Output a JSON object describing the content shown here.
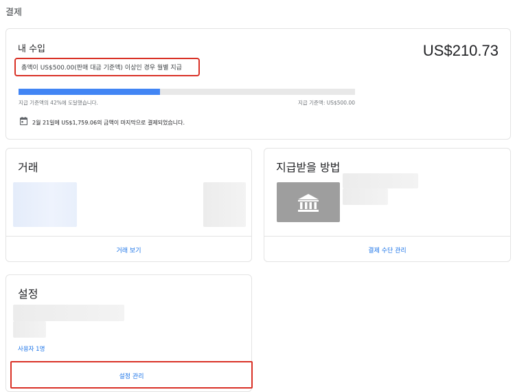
{
  "page": {
    "title": "결제"
  },
  "earnings": {
    "title": "내 수입",
    "amount": "US$210.73",
    "threshold_text": "총액이 US$500.00(판매 대금 기준액) 이상인 경우 월별 지급",
    "progress_fraction": 0.42,
    "progress_left_label": "지급 기준액의 42%에 도달했습니다.",
    "progress_right_label": "지급 기준액: US$500.00",
    "last_payment_text": "2월 21일에 US$1,759.06의 금액이 마지막으로 결제되었습니다.",
    "calendar_icon": "calendar-icon"
  },
  "transactions": {
    "title": "거래",
    "link": "거래 보기"
  },
  "payment_method": {
    "title": "지급받을 방법",
    "bank_icon": "bank-icon",
    "link": "결제 수단 관리"
  },
  "settings": {
    "title": "설정",
    "users_link": "사용자 1명",
    "manage_link": "설정 관리"
  },
  "colors": {
    "accent": "#1a73e8",
    "progress": "#4285f4",
    "highlight": "#d93025"
  }
}
